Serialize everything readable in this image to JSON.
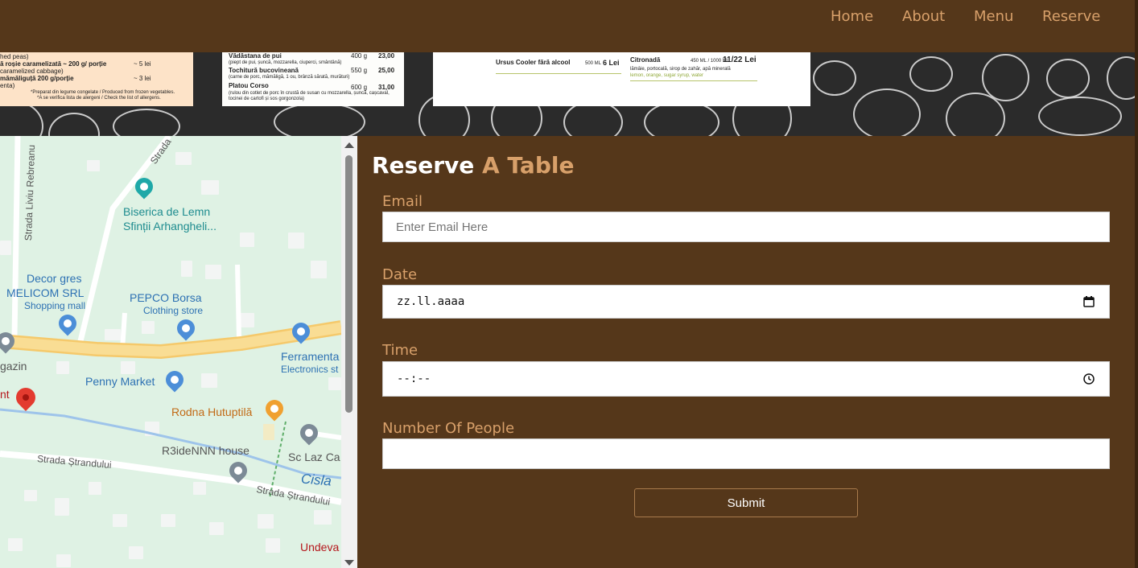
{
  "nav": {
    "items": [
      {
        "label": "Home"
      },
      {
        "label": "About"
      },
      {
        "label": "Menu"
      },
      {
        "label": "Reserve"
      }
    ]
  },
  "menu_images": {
    "card1": [
      "hed peas)",
      "ă roșie caramelizată ~ 200 g/ porție",
      "~ 5 lei",
      "caramelized cabbage)",
      "mămăliguță 200 g/porție",
      "~ 3 lei",
      "enta)",
      "*Preparat din legume congelate / Produced from frozen vegetables.",
      "*A se verifica lista de alergeni / Check the list of allergens."
    ],
    "card2": [
      "Vădăstana de pui",
      "400 g",
      "23,00",
      "(piept de pui, șuncă, mozzarella, ciuperci, smântână)",
      "Tochitură bucovineană",
      "550 g",
      "25,00",
      "(carne de porc, mămăligă, 1 ou, brânză sărată, murături)",
      "Platou Corso",
      "600 g",
      "31,00",
      "(rulou din cotlet de porc în crustă de susan cu mozzarella, șuncă, cașcaval,",
      "tocinei de cartofi și sos gorgonzola)"
    ],
    "card3": [
      "Ursus Cooler fără alcool",
      "500 ML",
      "6 Lei",
      "Citronadă",
      "450 ML / 1000 ML",
      "11/22 Lei",
      "lămâie, portocală, sirop de zahăr, apă minerală",
      "lemon, orange, sugar syrup, water"
    ]
  },
  "map": {
    "streets": [
      {
        "name": "Strada Liviu Rebreanu"
      },
      {
        "name": "Strada"
      },
      {
        "name": "Strada Ștrandului"
      },
      {
        "name": "Strada Ștrandului"
      }
    ],
    "places": [
      {
        "name": "Biserica de Lemn",
        "sub": "Sfinții Arhangheli..."
      },
      {
        "name": "Decor gres",
        "sub": "MELICOM SRL",
        "sub2": "Shopping mall"
      },
      {
        "name": "PEPCO Borsa",
        "sub": "Clothing store"
      },
      {
        "name": "Ferramenta",
        "sub": "Electronics st"
      },
      {
        "name": "gazin"
      },
      {
        "name": "Penny Market"
      },
      {
        "name": "nt"
      },
      {
        "name": "Rodna Hutuptilă"
      },
      {
        "name": "R3ideNNN house"
      },
      {
        "name": "Sc Laz Ca"
      },
      {
        "name": "Cisla"
      },
      {
        "name": "Undeva"
      }
    ]
  },
  "form": {
    "title_white": "Reserve",
    "title_orange": "A Table",
    "email_label": "Email",
    "email_placeholder": "Enter Email Here",
    "date_label": "Date",
    "date_value": "zz.ll.aaaa",
    "time_label": "Time",
    "time_value": "--:--",
    "people_label": "Number Of People",
    "people_value": "",
    "submit_label": "Submit"
  },
  "colors": {
    "background": "#55371a",
    "accent": "#d8a06a",
    "title_white": "#ffffff",
    "map_bg": "#dff2e4",
    "main_road": "#f7d88a",
    "water": "#9ec4ea"
  },
  "icons": [
    "calendar-icon",
    "clock-icon",
    "map-pin-red-icon",
    "church-icon",
    "shopping-bag-icon",
    "shopping-cart-icon",
    "restaurant-icon",
    "location-pin-icon",
    "scroll-up-arrow-icon",
    "scroll-down-arrow-icon"
  ]
}
